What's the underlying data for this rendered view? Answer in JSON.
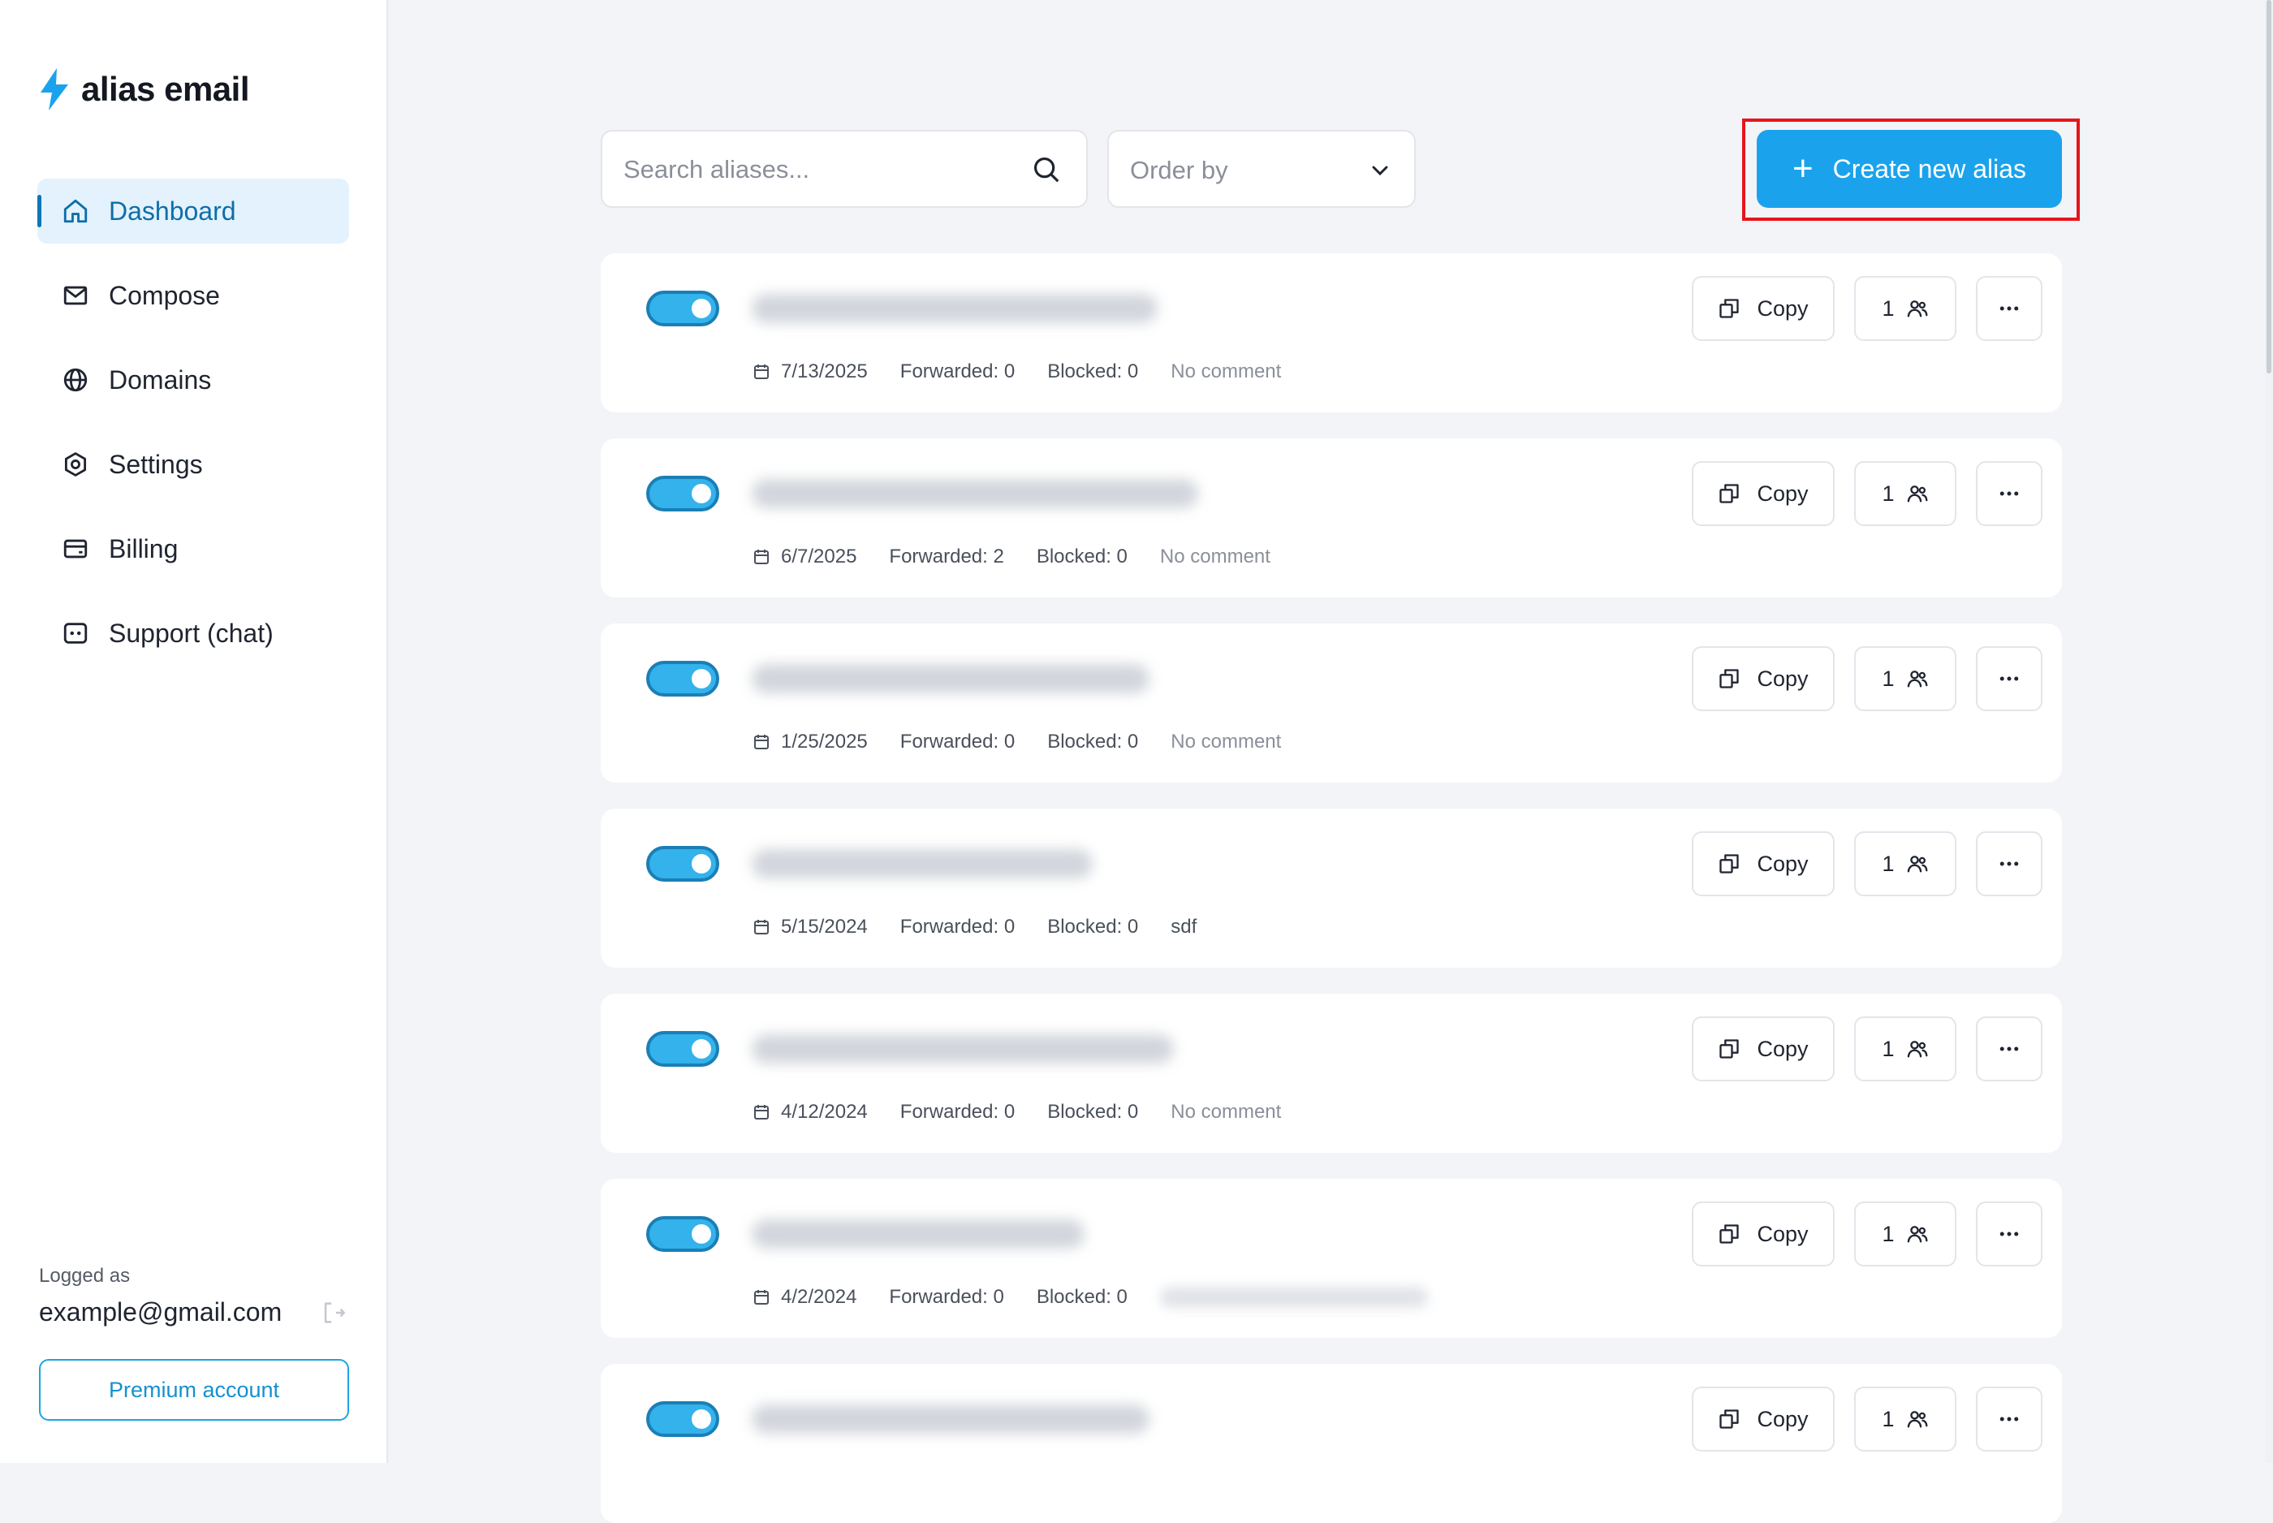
{
  "brand": {
    "name": "alias email",
    "accent": "#1aa3ec"
  },
  "sidebar": {
    "items": [
      {
        "label": "Dashboard",
        "icon": "home-icon",
        "active": true
      },
      {
        "label": "Compose",
        "icon": "mail-icon",
        "active": false
      },
      {
        "label": "Domains",
        "icon": "globe-icon",
        "active": false
      },
      {
        "label": "Settings",
        "icon": "gear-icon",
        "active": false
      },
      {
        "label": "Billing",
        "icon": "wallet-icon",
        "active": false
      },
      {
        "label": "Support (chat)",
        "icon": "chat-icon",
        "active": false
      }
    ],
    "logged_label": "Logged as",
    "email": "example@gmail.com",
    "premium_label": "Premium account"
  },
  "toolbar": {
    "search_placeholder": "Search aliases...",
    "order_label": "Order by",
    "create_label": "Create new alias"
  },
  "aliases": [
    {
      "enabled": true,
      "date": "7/13/2025",
      "forwarded": "Forwarded: 0",
      "blocked": "Blocked: 0",
      "comment": "No comment",
      "recipients": "1",
      "copy_label": "Copy"
    },
    {
      "enabled": true,
      "date": "6/7/2025",
      "forwarded": "Forwarded: 2",
      "blocked": "Blocked: 0",
      "comment": "No comment",
      "recipients": "1",
      "copy_label": "Copy"
    },
    {
      "enabled": true,
      "date": "1/25/2025",
      "forwarded": "Forwarded: 0",
      "blocked": "Blocked: 0",
      "comment": "No comment",
      "recipients": "1",
      "copy_label": "Copy"
    },
    {
      "enabled": true,
      "date": "5/15/2024",
      "forwarded": "Forwarded: 0",
      "blocked": "Blocked: 0",
      "comment": "sdf",
      "recipients": "1",
      "copy_label": "Copy"
    },
    {
      "enabled": true,
      "date": "4/12/2024",
      "forwarded": "Forwarded: 0",
      "blocked": "Blocked: 0",
      "comment": "No comment",
      "recipients": "1",
      "copy_label": "Copy"
    },
    {
      "enabled": true,
      "date": "4/2/2024",
      "forwarded": "Forwarded: 0",
      "blocked": "Blocked: 0",
      "comment": "",
      "recipients": "1",
      "copy_label": "Copy"
    },
    {
      "enabled": true,
      "date": "",
      "forwarded": "",
      "blocked": "",
      "comment": "",
      "recipients": "1",
      "copy_label": "Copy"
    }
  ]
}
